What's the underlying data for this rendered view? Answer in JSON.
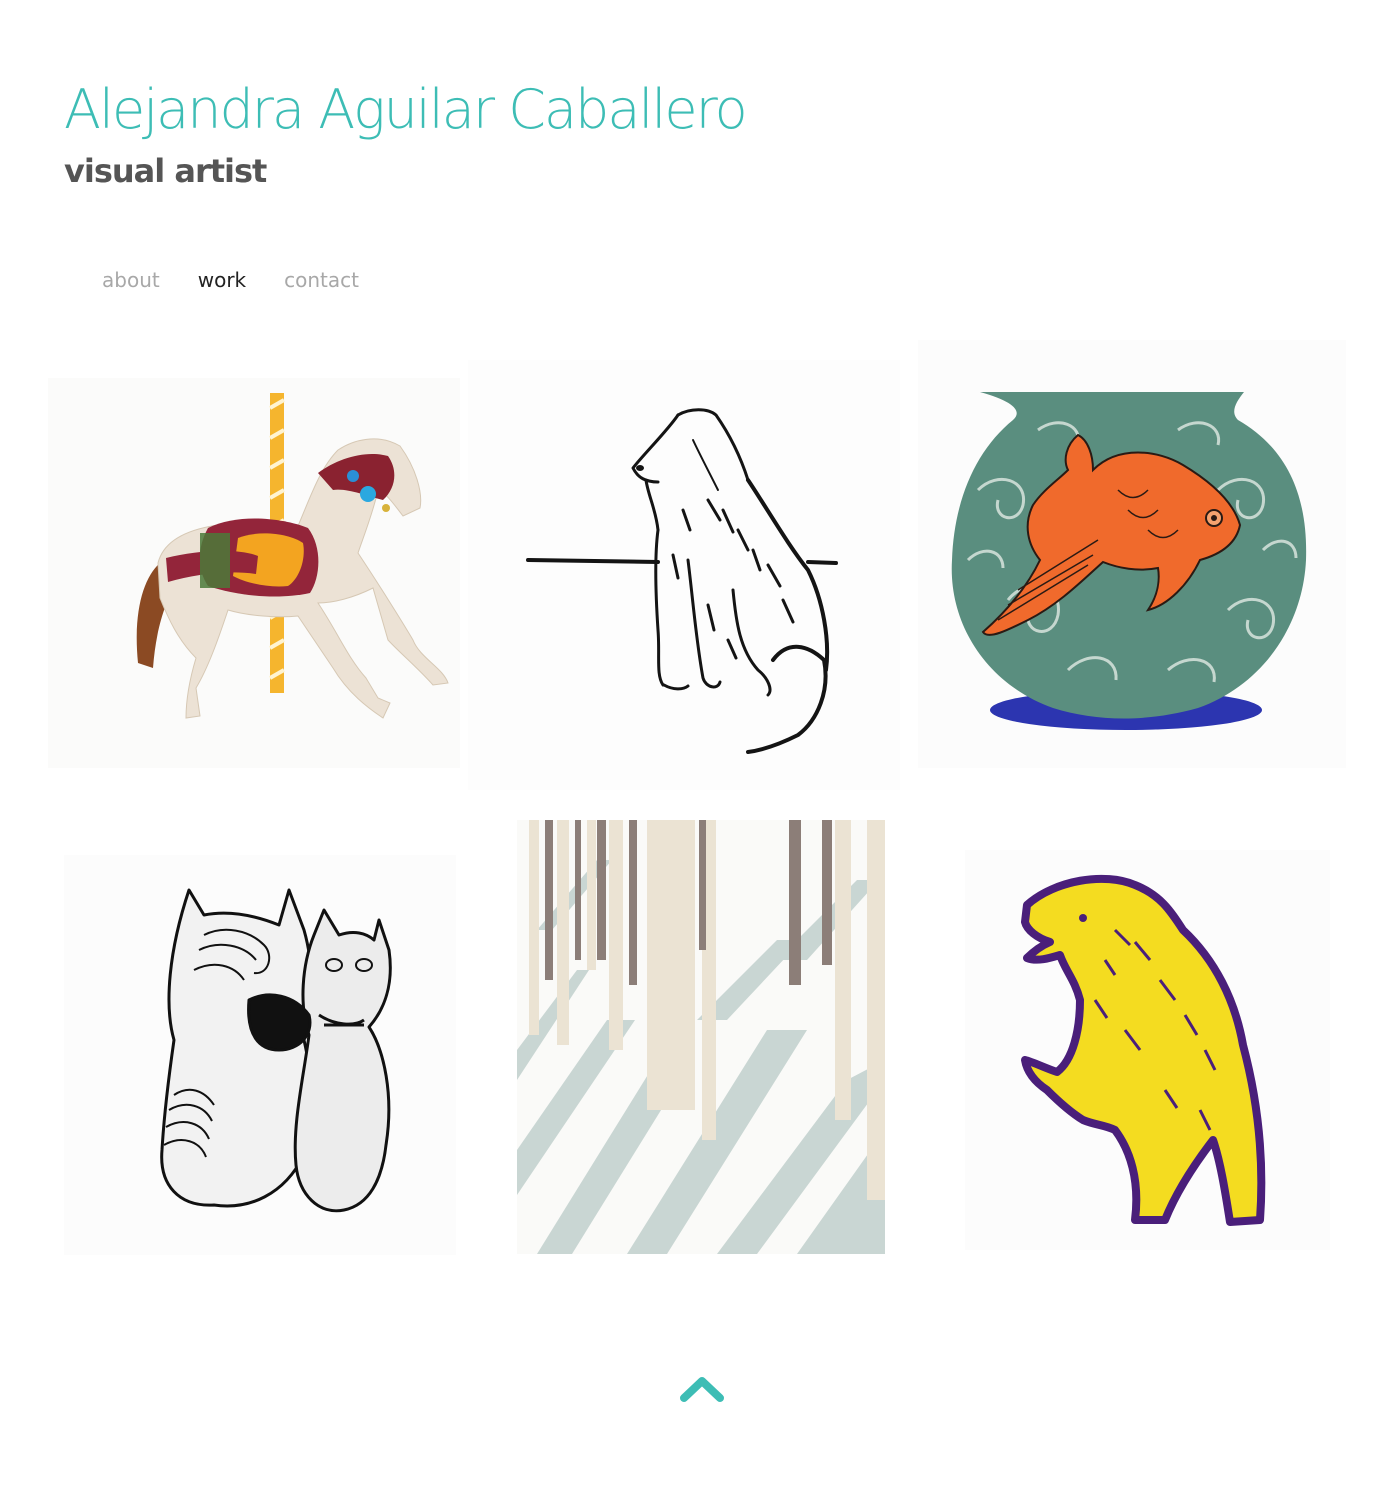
{
  "site": {
    "title": "Alejandra Aguilar Caballero",
    "tagline": "visual artist",
    "accent_color": "#3dbdb5"
  },
  "nav": {
    "items": [
      {
        "label": "about",
        "active": false
      },
      {
        "label": "work",
        "active": true
      },
      {
        "label": "contact",
        "active": false
      }
    ]
  },
  "gallery": {
    "items": [
      {
        "subject": "carousel horse",
        "icon": "carousel-horse-artwork"
      },
      {
        "subject": "sitting dog ink drawing",
        "icon": "dog-ink-drawing-artwork"
      },
      {
        "subject": "goldfish in bowl",
        "icon": "goldfish-bowl-artwork"
      },
      {
        "subject": "two embracing figures",
        "icon": "embracing-figures-artwork"
      },
      {
        "subject": "birch forest shadows",
        "icon": "forest-shadows-artwork"
      },
      {
        "subject": "yellow dog print",
        "icon": "yellow-dog-artwork"
      }
    ]
  },
  "footer": {
    "back_to_top_icon": "chevron-up-icon"
  }
}
